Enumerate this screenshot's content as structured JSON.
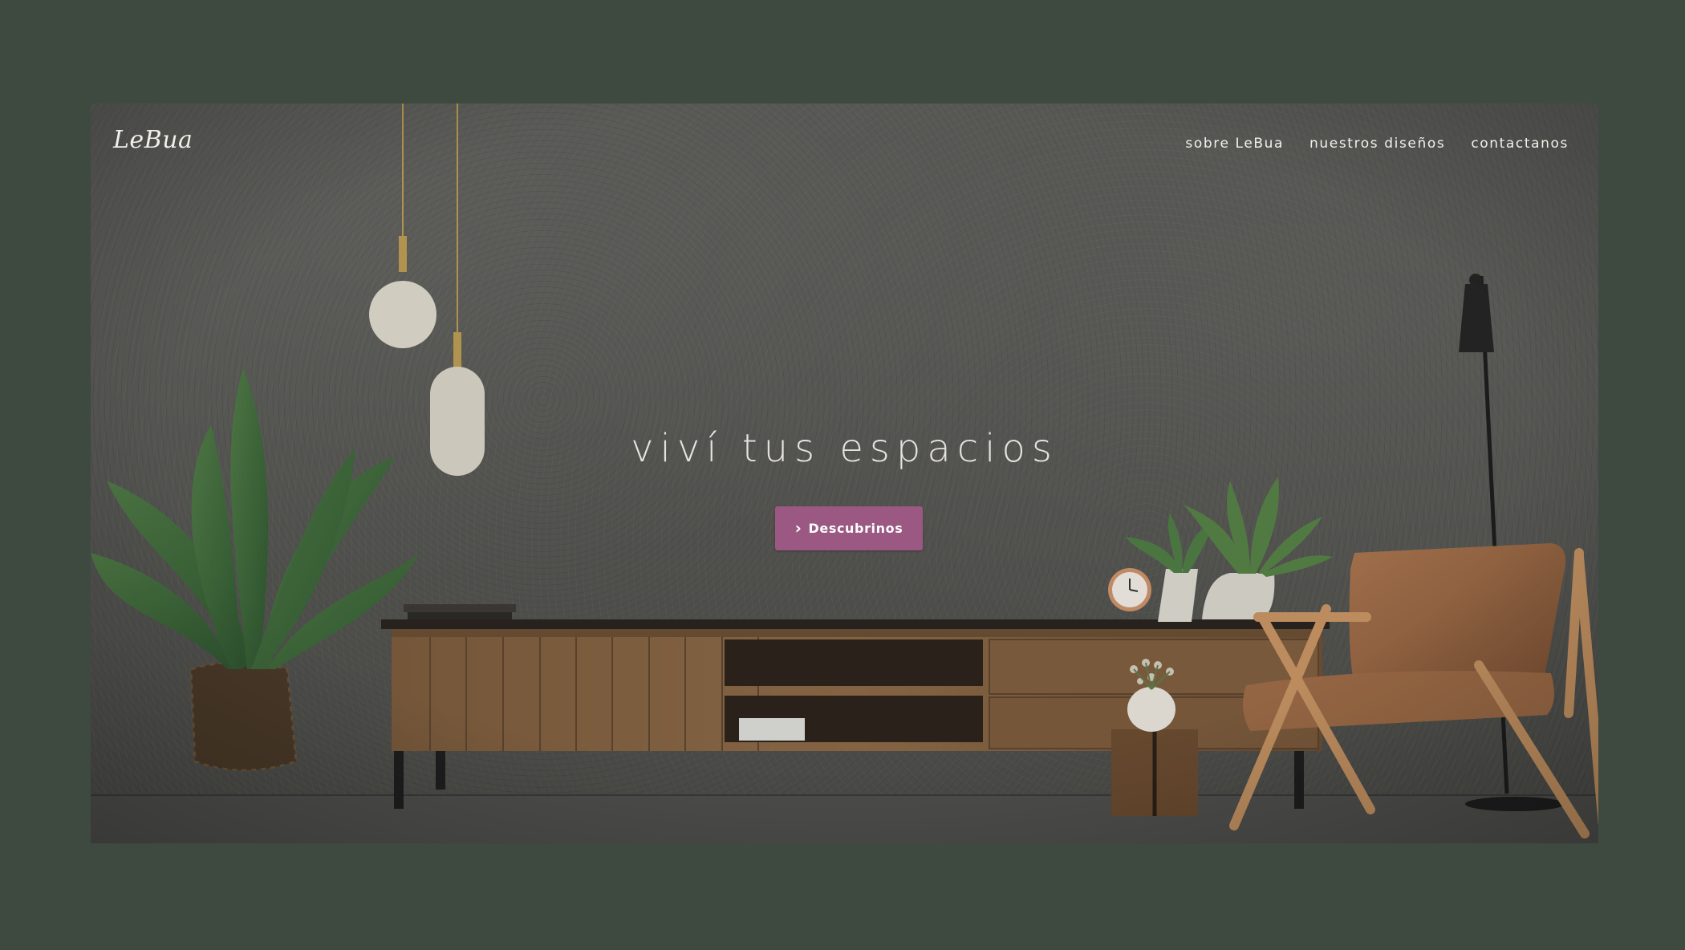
{
  "brand": {
    "logo_text": "LeBua"
  },
  "nav": {
    "items": [
      {
        "label": "sobre LeBua"
      },
      {
        "label": "nuestros diseños"
      },
      {
        "label": "contactanos"
      }
    ]
  },
  "hero": {
    "headline": "viví tus espacios",
    "cta_label": "Descubrinos",
    "cta_icon": "chevron-right-icon"
  },
  "colors": {
    "page_background": "#3e4a40",
    "accent": "#9a5882",
    "text_light": "#f2f0ea"
  }
}
